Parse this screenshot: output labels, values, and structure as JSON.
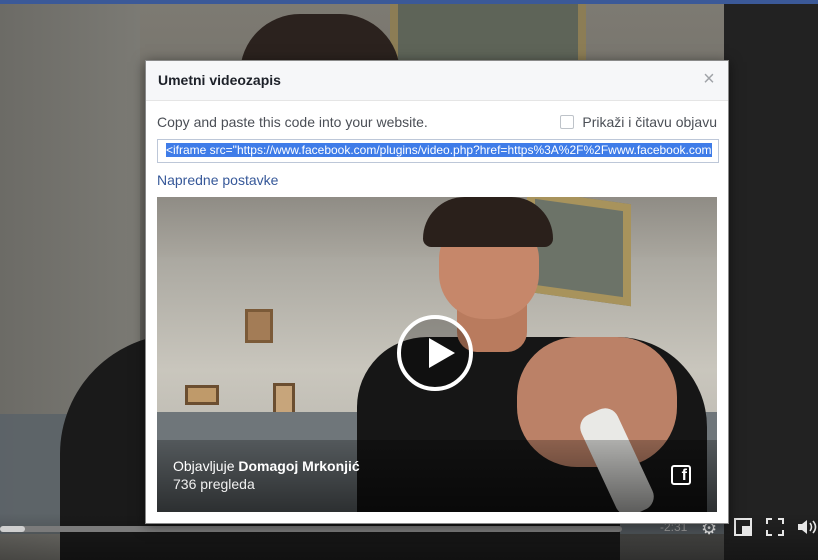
{
  "modal": {
    "title": "Umetni videozapis",
    "close_label": "×",
    "instructions": "Copy and paste this code into your website.",
    "checkbox_label": "Prikaži i čitavu objavu",
    "embed_code": "<iframe src=\"https://www.facebook.com/plugins/video.php?href=https%3A%2F%2Fwww.facebook.com",
    "advanced_link": "Napredne postavke"
  },
  "preview": {
    "posted_by_prefix": "Objavljuje",
    "author": "Domagoj Mrkonjić",
    "views": "736 pregleda",
    "brand_icon": "f"
  },
  "player": {
    "time_remaining": "-2:31",
    "progress_fraction": 0.04
  },
  "colors": {
    "link": "#365899",
    "selection": "#3f7ce8",
    "header_bg": "#f6f7f9",
    "topbar": "#3b5998"
  }
}
